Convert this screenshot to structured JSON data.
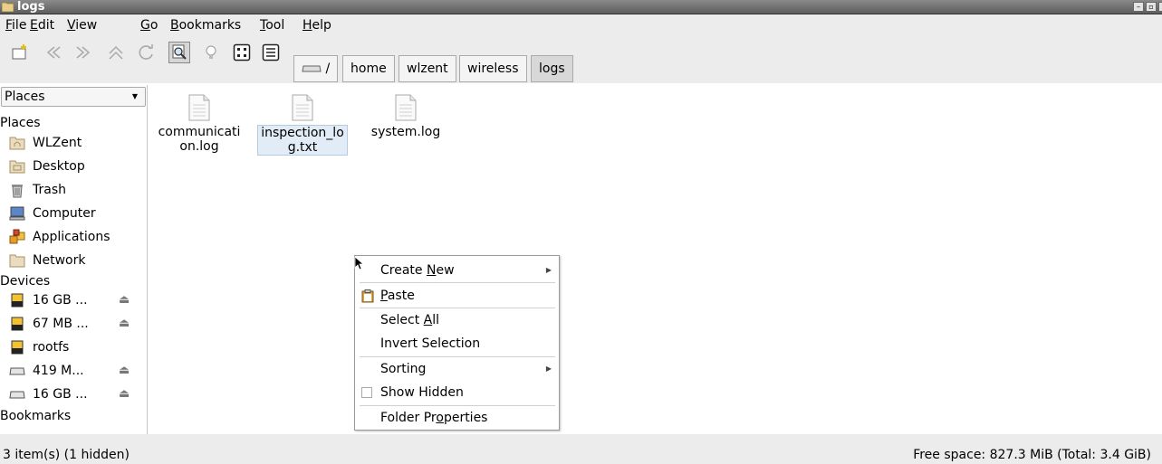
{
  "window": {
    "title": "logs",
    "buttons": [
      "–",
      "▫",
      "×"
    ]
  },
  "menubar": {
    "items": [
      {
        "pre": "",
        "u": "F",
        "post": "ile"
      },
      {
        "pre": "",
        "u": "E",
        "post": "dit"
      },
      {
        "pre": "",
        "u": "V",
        "post": "iew"
      },
      {
        "pre": "",
        "u": "G",
        "post": "o"
      },
      {
        "pre": "",
        "u": "B",
        "post": "ookmarks"
      },
      {
        "pre": "",
        "u": "T",
        "post": "ool"
      },
      {
        "pre": "",
        "u": "H",
        "post": "elp"
      }
    ]
  },
  "toolbar": {
    "path_root": "/",
    "breadcrumbs": [
      "home",
      "wlzent",
      "wireless",
      "logs"
    ]
  },
  "sidebar": {
    "dropdown": "Places",
    "places_header": "Places",
    "places": [
      "WLZent",
      "Desktop",
      "Trash",
      "Computer",
      "Applications",
      "Network"
    ],
    "devices_header": "Devices",
    "devices": [
      "16 GB ...",
      "67 MB ...",
      "rootfs",
      "419 M...",
      "16 GB ..."
    ],
    "bookmarks_header": "Bookmarks"
  },
  "files": [
    {
      "name": "communication.log",
      "line1": "communicati",
      "line2": "on.log",
      "selected": false
    },
    {
      "name": "inspection_log.txt",
      "line1": "inspection_lo",
      "line2": "g.txt",
      "selected": true
    },
    {
      "name": "system.log",
      "line1": "system.log",
      "line2": "",
      "selected": false
    }
  ],
  "context_menu": {
    "create_new": {
      "pre": "Create ",
      "u": "N",
      "post": "ew"
    },
    "paste": {
      "pre": "",
      "u": "P",
      "post": "aste"
    },
    "select_all": {
      "pre": "Select ",
      "u": "A",
      "post": "ll"
    },
    "invert_selection": "Invert Selection",
    "sorting": "Sorting",
    "show_hidden": "Show Hidden",
    "folder_properties": {
      "pre": "Folder Pr",
      "u": "o",
      "post": "perties"
    }
  },
  "status": {
    "left": "3 item(s) (1 hidden)",
    "right": "Free space: 827.3 MiB (Total: 3.4 GiB)"
  },
  "colors": {
    "selection": "#e2ecf6",
    "chrome": "#ececec",
    "titlebar": "#6e6e6e"
  }
}
